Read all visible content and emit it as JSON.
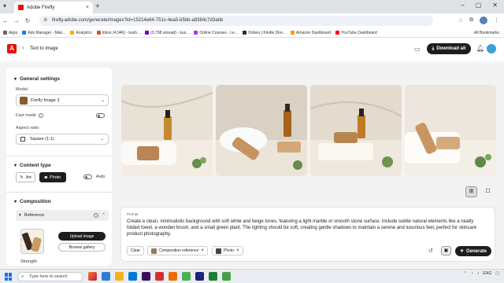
{
  "browser": {
    "tab_title": "Adobe Firefly",
    "tab_close_icon": "×",
    "new_tab_icon": "+",
    "url": "firefly.adobe.com/generate/images?id=15214e64-751c-4ea5-b5bb-a8384c7d3abb",
    "window_controls": [
      "–",
      "▢",
      "✕"
    ]
  },
  "bookmarks": [
    {
      "label": "Apps",
      "color": "#5f6368"
    },
    {
      "label": "Ads Manager - Man...",
      "color": "#1877f2"
    },
    {
      "label": "Analytics",
      "color": "#f9ab00"
    },
    {
      "label": "Inbox (4,946) - kush...",
      "color": "#ea4335"
    },
    {
      "label": "(3,738 unread) - kus...",
      "color": "#6001d2"
    },
    {
      "label": "Online Courses - Le...",
      "color": "#a435f0"
    },
    {
      "label": "Orders | Kindle Dire...",
      "color": "#232f3e"
    },
    {
      "label": "Amazon Dashboard",
      "color": "#ff9900"
    },
    {
      "label": "YouTube Dashboard",
      "color": "#ff0000"
    }
  ],
  "all_bookmarks": "All Bookmarks",
  "app": {
    "logo_letter": "A",
    "back_label": "Text to image",
    "download_all": "Download all"
  },
  "settings": {
    "general_title": "General settings",
    "model_label": "Model",
    "model_value": "Firefly Image 3",
    "fast_mode_label": "Fast mode",
    "aspect_label": "Aspect ratio",
    "aspect_value": "Square (1:1)",
    "content_type_title": "Content type",
    "content_art": "Art",
    "content_photo": "Photo",
    "auto_label": "Auto",
    "composition_title": "Composition",
    "reference_label": "Reference",
    "upload_image": "Upload image",
    "browse_gallery": "Browse gallery",
    "strength_label": "Strength"
  },
  "prompt": {
    "label": "Prompt",
    "text": "Create a clean, minimalistic background with soft white and beige tones, featuring a light marble or smooth stone surface. Include subtle natural elements like a neatly folded towel, a wooden brush, and a small green plant. The lighting should be soft, creating gentle shadows to maintain a serene and luxurious feel, perfect for skincare product photography.",
    "clear": "Clear",
    "chip_composition": "Composition reference",
    "chip_photo": "Photo",
    "generate": "Generate"
  },
  "taskbar": {
    "search_placeholder": "Type here to search",
    "lang": "ENG"
  },
  "colors": {
    "accent": "#eb1000",
    "dark_button": "#1e1e1e"
  }
}
